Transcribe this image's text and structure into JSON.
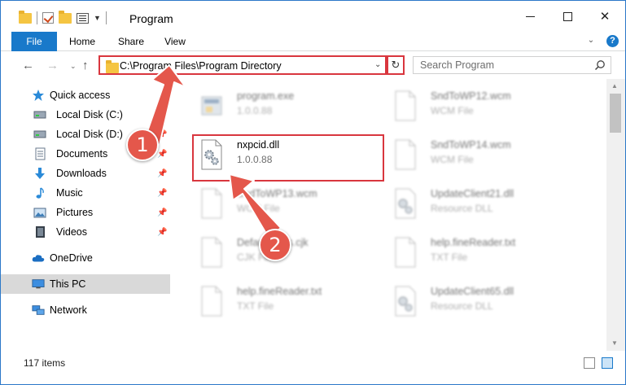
{
  "window": {
    "title": "Program",
    "quick_access_icons": [
      "folder-icon",
      "checkmark-properties-icon",
      "folder-icon",
      "properties-icon"
    ]
  },
  "ribbon": {
    "tabs": [
      "File",
      "Home",
      "Share",
      "View"
    ],
    "help": "?"
  },
  "navigation": {
    "address": "C:\\Program Files\\Program Directory",
    "search_placeholder": "Search Program"
  },
  "sidebar": {
    "items": [
      {
        "label": "Quick access",
        "icon": "star-icon",
        "pinned": false
      },
      {
        "label": "Local Disk (C:)",
        "icon": "disk-icon",
        "pinned": true
      },
      {
        "label": "Local Disk (D:)",
        "icon": "disk-icon",
        "pinned": true
      },
      {
        "label": "Documents",
        "icon": "documents-icon",
        "pinned": true
      },
      {
        "label": "Downloads",
        "icon": "download-icon",
        "pinned": true
      },
      {
        "label": "Music",
        "icon": "music-icon",
        "pinned": true
      },
      {
        "label": "Pictures",
        "icon": "pictures-icon",
        "pinned": true
      },
      {
        "label": "Videos",
        "icon": "videos-icon",
        "pinned": true
      },
      {
        "label": "OneDrive",
        "icon": "cloud-icon",
        "pinned": false
      },
      {
        "label": "This PC",
        "icon": "computer-icon",
        "pinned": false,
        "selected": true
      },
      {
        "label": "Network",
        "icon": "network-icon",
        "pinned": false
      }
    ]
  },
  "files": [
    {
      "name": "program.exe",
      "type": "1.0.0.88",
      "icon": "exe-icon",
      "highlighted": false
    },
    {
      "name": "SndToWP12.wcm",
      "type": "WCM File",
      "icon": "file-icon",
      "highlighted": false
    },
    {
      "name": "nxpcid.dll",
      "type": "1.0.0.88",
      "icon": "dll-gear-icon",
      "highlighted": true
    },
    {
      "name": "SndToWP14.wcm",
      "type": "WCM File",
      "icon": "file-icon",
      "highlighted": false
    },
    {
      "name": "SndToWP13.wcm",
      "type": "WCM File",
      "icon": "file-icon",
      "highlighted": false
    },
    {
      "name": "UpdateClient21.dll",
      "type": "Resource DLL",
      "icon": "dll-gear-icon",
      "highlighted": false
    },
    {
      "name": "DefaultParts.cjk",
      "type": "CJK File",
      "icon": "file-icon",
      "highlighted": false
    },
    {
      "name": "help.fineReader.txt",
      "type": "TXT File",
      "icon": "file-icon",
      "highlighted": false
    },
    {
      "name": "help.fineReader.txt",
      "type": "TXT File",
      "icon": "file-icon",
      "highlighted": false
    },
    {
      "name": "UpdateClient65.dll",
      "type": "Resource DLL",
      "icon": "dll-gear-icon",
      "highlighted": false
    }
  ],
  "status": {
    "item_count": "117 items"
  },
  "annotations": {
    "step1": "1",
    "step2": "2",
    "color": "#e4574b"
  }
}
